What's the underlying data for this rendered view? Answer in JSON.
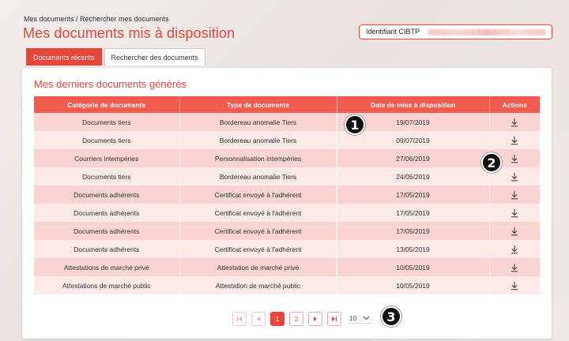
{
  "breadcrumb": "Mes documents / Rechercher mes documents",
  "page_title": "Mes documents mis à disposition",
  "identifier": {
    "label": "Identifiant CIBTP"
  },
  "tabs": [
    {
      "label": "Documents récents"
    },
    {
      "label": "Rechercher des documents"
    }
  ],
  "section_title": "Mes derniers documents générés",
  "table": {
    "headers": [
      "Catégorie de documents",
      "Type de documents",
      "Date de mise à disposition",
      "Actions"
    ],
    "rows": [
      [
        "Documents tiers",
        "Bordereau anomalie Tiers",
        "19/07/2019"
      ],
      [
        "Documents tiers",
        "Bordereau anomalie Tiers",
        "09/07/2019"
      ],
      [
        "Courriers intempéries",
        "Personnalisation intempéries",
        "27/06/2019"
      ],
      [
        "Documents tiers",
        "Bordereau anomalie Tiers",
        "24/06/2019"
      ],
      [
        "Documents adhérents",
        "Certificat envoyé à l'adhérent",
        "17/05/2019"
      ],
      [
        "Documents adhérents",
        "Certificat envoyé à l'adhérent",
        "17/05/2019"
      ],
      [
        "Documents adhérents",
        "Certificat envoyé à l'adhérent",
        "17/05/2019"
      ],
      [
        "Documents adhérents",
        "Certificat envoyé à l'adhérent",
        "13/05/2019"
      ],
      [
        "Attestations de marché privé",
        "Attestation de marché privé",
        "10/05/2019"
      ],
      [
        "Attestations de marché public",
        "Attestation de marché public",
        "10/05/2019"
      ]
    ]
  },
  "pagination": {
    "pages": [
      "1",
      "2"
    ],
    "current_page": "1",
    "page_size": "10"
  },
  "badges": [
    "1",
    "2",
    "3"
  ],
  "colors": {
    "accent": "#e8463b",
    "header_bg": "#f05a4f",
    "row_odd": "#f9d4d1",
    "row_even": "#fde9e7"
  },
  "icons": {
    "download": "download-icon",
    "first": "first-page-icon",
    "prev": "prev-page-icon",
    "next": "next-page-icon",
    "last": "last-page-icon"
  }
}
